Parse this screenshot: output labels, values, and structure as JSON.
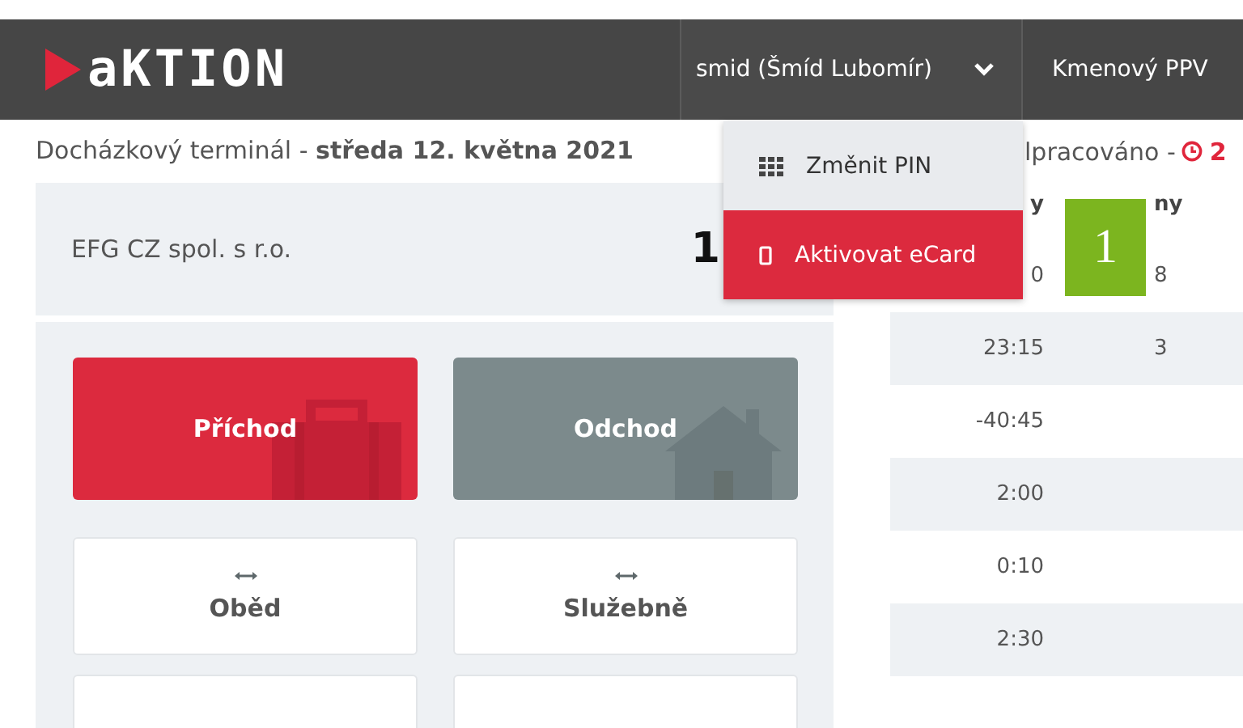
{
  "header": {
    "logo": "aKTION",
    "user_menu": {
      "label": "smid (Šmíd Lubomír)",
      "expanded": true
    },
    "unit": "Kmenový PPV"
  },
  "dropdown": [
    {
      "kind": "grid",
      "label": "Změnit PIN",
      "selected": false
    },
    {
      "kind": "phone",
      "label": "Aktivovat eCard",
      "selected": true
    }
  ],
  "subtitle": "Docházkový terminál - **středa 12. května 2021**",
  "summary": {
    "label": "lpracováno -",
    "value": "2"
  },
  "company": {
    "name": "EFG CZ spol. s r.o.",
    "time": "1"
  },
  "actions": [
    {
      "kind": "arrival",
      "label": "Příchod"
    },
    {
      "kind": "departure",
      "label": "Odchod"
    },
    {
      "kind": "pass",
      "label": "Oběd"
    },
    {
      "kind": "pass",
      "label": "Služebně"
    },
    {
      "kind": "pass"
    },
    {
      "kind": "pass"
    }
  ],
  "table": {
    "columns": [
      "y",
      "ny"
    ],
    "rows": [
      {
        "column_1": "0",
        "column_2": "8"
      },
      {
        "column_1": "23:15",
        "column_2": "3"
      },
      {
        "column_1": "-40:45"
      },
      {
        "column_1": "2:00"
      },
      {
        "column_1": "0:10"
      },
      {
        "column_1": "2:30"
      }
    ]
  },
  "marker": "1"
}
